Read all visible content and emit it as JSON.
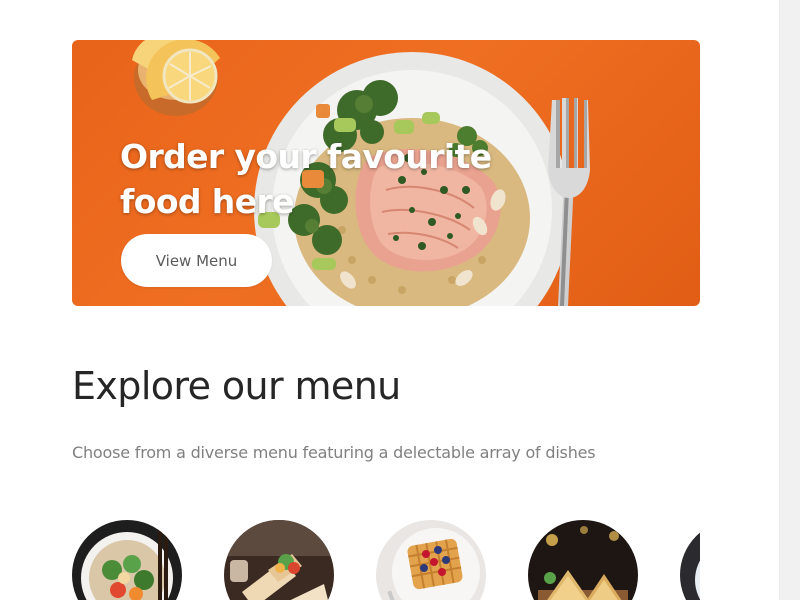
{
  "hero": {
    "title": "Order your favourite food here",
    "button_label": "View Menu",
    "accent_color": "#e8631a"
  },
  "menu": {
    "title": "Explore our menu",
    "subtitle": "Choose from a diverse menu featuring a delectable array of dishes",
    "items": [
      {
        "icon": "salad-bowl-image"
      },
      {
        "icon": "wraps-image"
      },
      {
        "icon": "waffle-image"
      },
      {
        "icon": "sandwich-image"
      },
      {
        "icon": "bowl-image"
      }
    ]
  }
}
